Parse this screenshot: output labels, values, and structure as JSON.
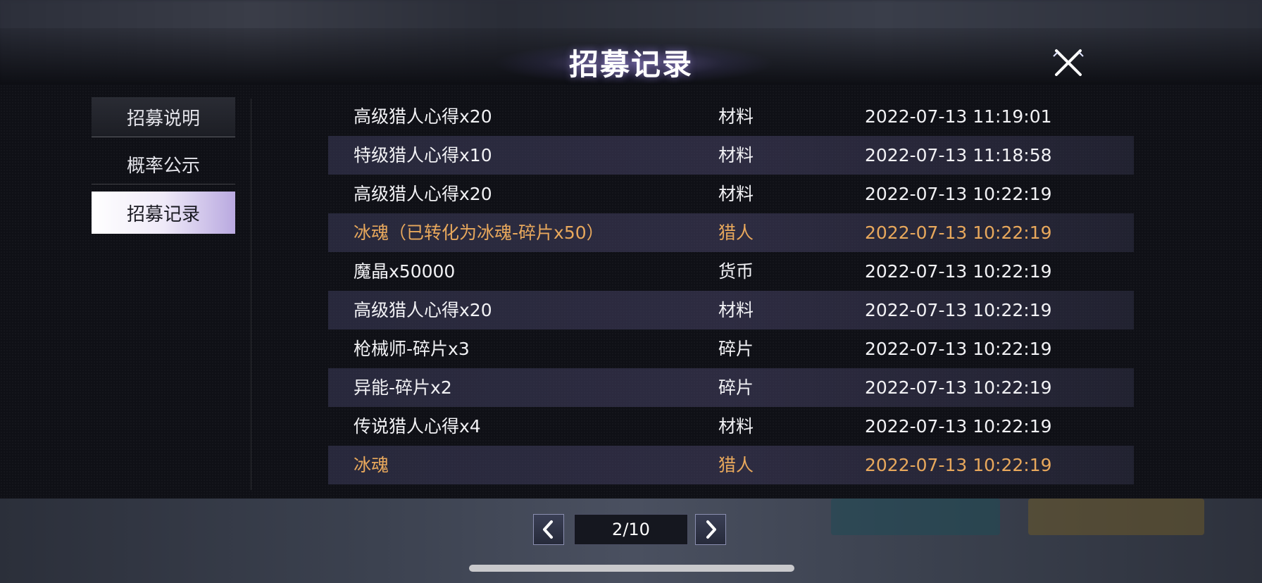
{
  "title": "招募记录",
  "sidebar": {
    "items": [
      {
        "label": "招募说明"
      },
      {
        "label": "概率公示"
      },
      {
        "label": "招募记录"
      }
    ]
  },
  "records": [
    {
      "name": "高级猎人心得x20",
      "type": "材料",
      "time": "2022-07-13 11:19:01"
    },
    {
      "name": "特级猎人心得x10",
      "type": "材料",
      "time": "2022-07-13 11:18:58"
    },
    {
      "name": "高级猎人心得x20",
      "type": "材料",
      "time": "2022-07-13 10:22:19"
    },
    {
      "name": "冰魂（已转化为冰魂-碎片x50）",
      "type": "猎人",
      "time": "2022-07-13 10:22:19"
    },
    {
      "name": "魔晶x50000",
      "type": "货币",
      "time": "2022-07-13 10:22:19"
    },
    {
      "name": "高级猎人心得x20",
      "type": "材料",
      "time": "2022-07-13 10:22:19"
    },
    {
      "name": "枪械师-碎片x3",
      "type": "碎片",
      "time": "2022-07-13 10:22:19"
    },
    {
      "name": "异能-碎片x2",
      "type": "碎片",
      "time": "2022-07-13 10:22:19"
    },
    {
      "name": "传说猎人心得x4",
      "type": "材料",
      "time": "2022-07-13 10:22:19"
    },
    {
      "name": "冰魂",
      "type": "猎人",
      "time": "2022-07-13 10:22:19"
    }
  ],
  "pager": {
    "page_text": "2/10"
  },
  "colors": {
    "highlight": "#e8a85c",
    "text": "#f2f2f5",
    "active_tab": "#efeaf8"
  }
}
